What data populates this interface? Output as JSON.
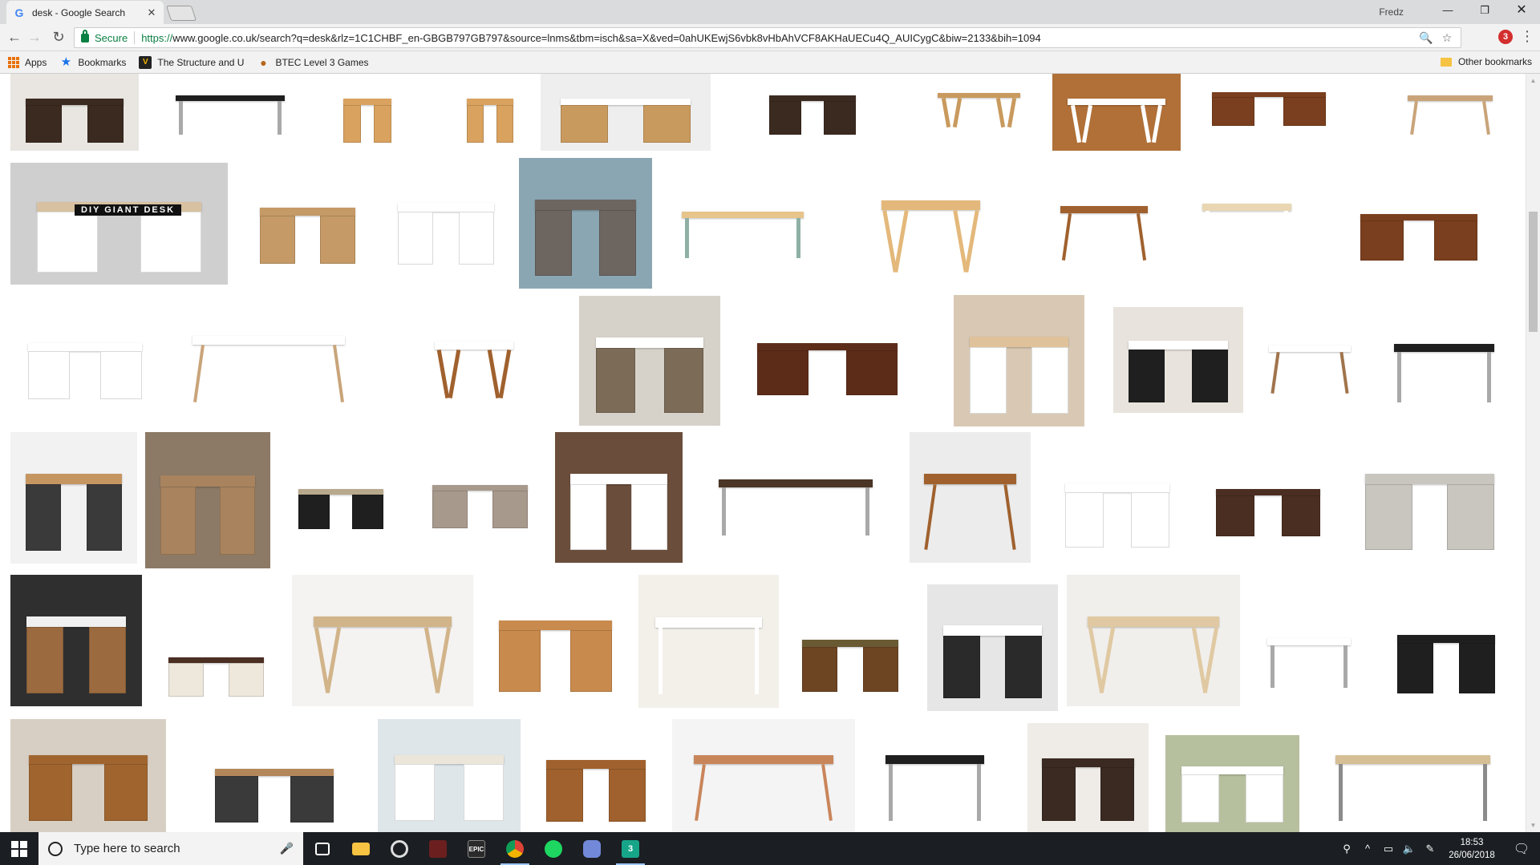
{
  "tab": {
    "title": "desk - Google Search",
    "close": "✕",
    "favicon": "G"
  },
  "profile": "Fredz",
  "window_controls": {
    "minimize": "—",
    "maximize": "❐",
    "close": "✕"
  },
  "nav": {
    "back": "←",
    "forward": "→",
    "reload": "↻"
  },
  "omnibox": {
    "secure_label": "Secure",
    "url_proto": "https://",
    "url_rest": "www.google.co.uk/search?q=desk&rlz=1C1CHBF_en-GBGB797GB797&source=lnms&tbm=isch&sa=X&ved=0ahUKEwjS6vbk8vHbAhVCF8AKHaUECu4Q_AUICygC&biw=2133&bih=1094",
    "zoom_icon": "🔍",
    "star_icon": "☆",
    "extension_badge": "3",
    "menu_icon": "⋮"
  },
  "bookmarks": {
    "apps": "Apps",
    "bookmarks": "Bookmarks",
    "structure": "The Structure and U",
    "btec": "BTEC Level 3 Games",
    "other": "Other bookmarks"
  },
  "results": {
    "images": [
      {
        "alt": "dark wood desk",
        "row": 0
      },
      {
        "alt": "black metal desk",
        "row": 0
      },
      {
        "alt": "pine drawer unit",
        "row": 0
      },
      {
        "alt": "pine cabinet",
        "row": 0
      },
      {
        "alt": "white desk with chair",
        "row": 0
      },
      {
        "alt": "dark wood desk",
        "row": 0
      },
      {
        "alt": "wooden trestle desk",
        "row": 0
      },
      {
        "alt": "white desk on wood floor",
        "row": 0
      },
      {
        "alt": "mahogany desk",
        "row": 0
      },
      {
        "alt": "wooden legs desk",
        "row": 0
      },
      {
        "alt": "DIY giant desk",
        "row": 1,
        "caption": "DIY GIANT DESK"
      }
    ]
  },
  "taskbar": {
    "search_placeholder": "Type here to search",
    "time": "18:53",
    "date": "26/06/2018",
    "apps": [
      "task-view",
      "file-explorer",
      "overwatch",
      "game",
      "epic-games",
      "chrome",
      "spotify",
      "discord",
      "app-3"
    ]
  }
}
